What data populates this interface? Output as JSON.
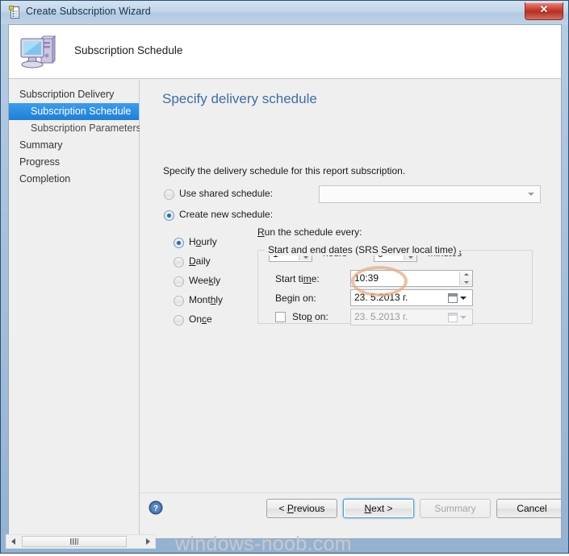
{
  "window": {
    "title": "Create Subscription Wizard",
    "title_icon": "wizard-checklist-icon",
    "close_label": "✕"
  },
  "banner": {
    "title": "Subscription Schedule",
    "icon": "computer-monitor-icon"
  },
  "sidebar": {
    "items": [
      {
        "label": "Subscription Delivery",
        "level": 0,
        "selected": false
      },
      {
        "label": "Subscription Schedule",
        "level": 1,
        "selected": true
      },
      {
        "label": "Subscription Parameters",
        "level": 1,
        "selected": false
      },
      {
        "label": "Summary",
        "level": 0,
        "selected": false
      },
      {
        "label": "Progress",
        "level": 0,
        "selected": false
      },
      {
        "label": "Completion",
        "level": 0,
        "selected": false
      }
    ]
  },
  "page": {
    "heading": "Specify delivery schedule",
    "description": "Specify the delivery schedule for this report subscription.",
    "schedule_source": {
      "shared": {
        "label": "Use shared schedule:",
        "selected": false
      },
      "new": {
        "label": "Create new schedule:",
        "selected": true
      },
      "shared_combo_value": "",
      "shared_combo_placeholder": ""
    },
    "frequency": {
      "options": [
        {
          "label": "Hourly",
          "selected": true
        },
        {
          "label": "Daily",
          "selected": false
        },
        {
          "label": "Weekly",
          "selected": false
        },
        {
          "label": "Monthly",
          "selected": false
        },
        {
          "label": "Once",
          "selected": false
        }
      ]
    },
    "recurrence": {
      "title": "Run the schedule every:",
      "hours_value": "1",
      "hours_label": "hours",
      "minutes_value": "0",
      "minutes_label": "minutes"
    },
    "dates_group": {
      "title": "Start and end dates (SRS Server local time)",
      "start_time_label": "Start time:",
      "start_time_value": "10:39",
      "begin_on_label": "Begin on:",
      "begin_on_value": "23. 5.2013 г.",
      "stop_on_label": "Stop on:",
      "stop_on_value": "23. 5.2013 г.",
      "stop_on_checked": false
    },
    "annotation": {
      "shape": "ellipse-highlight",
      "color": "#e8a97e",
      "target": "start-time-field"
    }
  },
  "footer": {
    "help_icon": "help-question-icon",
    "buttons": [
      {
        "label": "< Previous",
        "state": "enabled",
        "default": false
      },
      {
        "label": "Next >",
        "state": "enabled",
        "default": true
      },
      {
        "label": "Summary",
        "state": "disabled",
        "default": false
      },
      {
        "label": "Cancel",
        "state": "enabled",
        "default": false
      }
    ]
  },
  "watermark": {
    "text": "windows-noob.com"
  },
  "colors": {
    "accent_blue": "#1d7fd8",
    "heading_blue": "#3b6ea5",
    "annotation_orange": "#e8a97e",
    "close_red": "#b62f23"
  }
}
